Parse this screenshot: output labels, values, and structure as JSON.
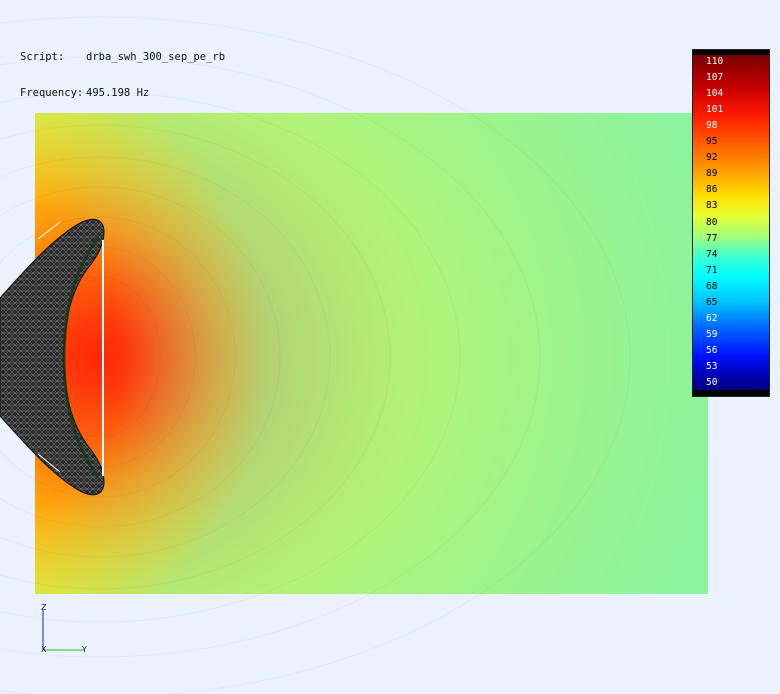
{
  "header": {
    "script_label": "Script:",
    "script_value": "drba_swh_300_sep_pe_rb",
    "frequency_label": "Frequency:",
    "frequency_value": "495.198 Hz"
  },
  "legend": {
    "ticks": [
      "110",
      "107",
      "104",
      "101",
      "98",
      "95",
      "92",
      "89",
      "86",
      "83",
      "80",
      "77",
      "74",
      "71",
      "68",
      "65",
      "62",
      "59",
      "56",
      "53",
      "50"
    ],
    "label_colors": [
      "#ffffff",
      "#ffffff",
      "#ffffff",
      "#ffffff",
      "#ffffff",
      "#000000",
      "#000000",
      "#000000",
      "#000000",
      "#000000",
      "#000000",
      "#000000",
      "#000000",
      "#000000",
      "#000000",
      "#000000",
      "#ffffff",
      "#ffffff",
      "#ffffff",
      "#ffffff",
      "#ffffff"
    ]
  },
  "axes": {
    "z_label": "Z",
    "x_label": "X",
    "y_label": "Y"
  },
  "colors": {
    "background": "#eaf3fd",
    "field_edge": "#a8fa70",
    "field_peak": "#ff2a08",
    "horn_body": "#1a1a1a",
    "horn_highlight": "#ffffff"
  }
}
